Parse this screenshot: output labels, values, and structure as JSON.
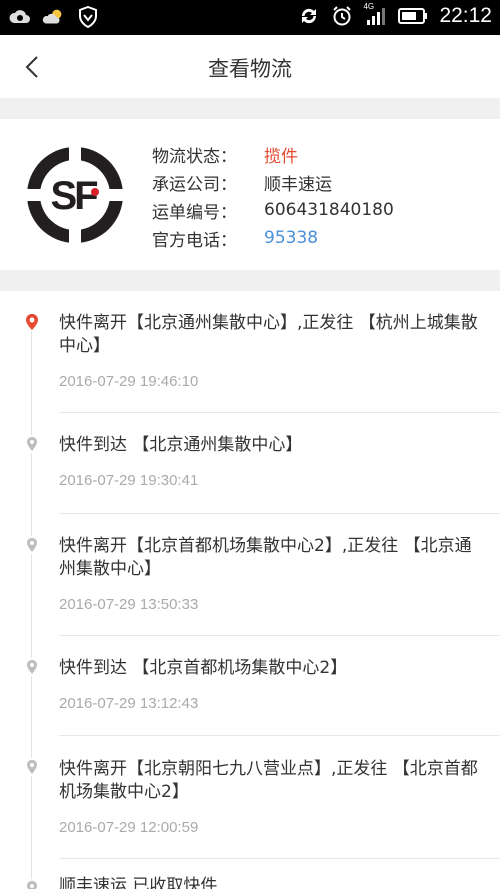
{
  "status_bar": {
    "time": "22:12",
    "network": "4G",
    "left_icons": [
      "cloud-sync-icon",
      "weather-icon",
      "shield-icon"
    ],
    "right_icons": [
      "sync-icon",
      "alarm-icon",
      "signal-icon",
      "battery-icon"
    ]
  },
  "header": {
    "title": "查看物流",
    "back_icon": "chevron-left-icon"
  },
  "shipment": {
    "logo_text": "SF",
    "rows": [
      {
        "label": "物流状态：",
        "value": "揽件"
      },
      {
        "label": "承运公司：",
        "value": "顺丰速运"
      },
      {
        "label": "运单编号：",
        "value": "606431840180"
      },
      {
        "label": "官方电话：",
        "value": "95338"
      }
    ]
  },
  "timeline": [
    {
      "text": "快件离开【北京通州集散中心】,正发往 【杭州上城集散中心】",
      "time": "2016-07-29 19:46:10",
      "current": true
    },
    {
      "text": "快件到达 【北京通州集散中心】",
      "time": "2016-07-29 19:30:41",
      "current": false
    },
    {
      "text": "快件离开【北京首都机场集散中心2】,正发往 【北京通州集散中心】",
      "time": "2016-07-29 13:50:33",
      "current": false
    },
    {
      "text": "快件到达 【北京首都机场集散中心2】",
      "time": "2016-07-29 13:12:43",
      "current": false
    },
    {
      "text": "快件离开【北京朝阳七九八营业点】,正发往 【北京首都机场集散中心2】",
      "time": "2016-07-29 12:00:59",
      "current": false
    },
    {
      "text": "顺丰速运 已收取快件",
      "time": "",
      "current": false
    }
  ],
  "colors": {
    "accent": "#e5492f",
    "link": "#4a90d9",
    "muted": "#aaaaaa",
    "divider": "#f0f0f0"
  }
}
